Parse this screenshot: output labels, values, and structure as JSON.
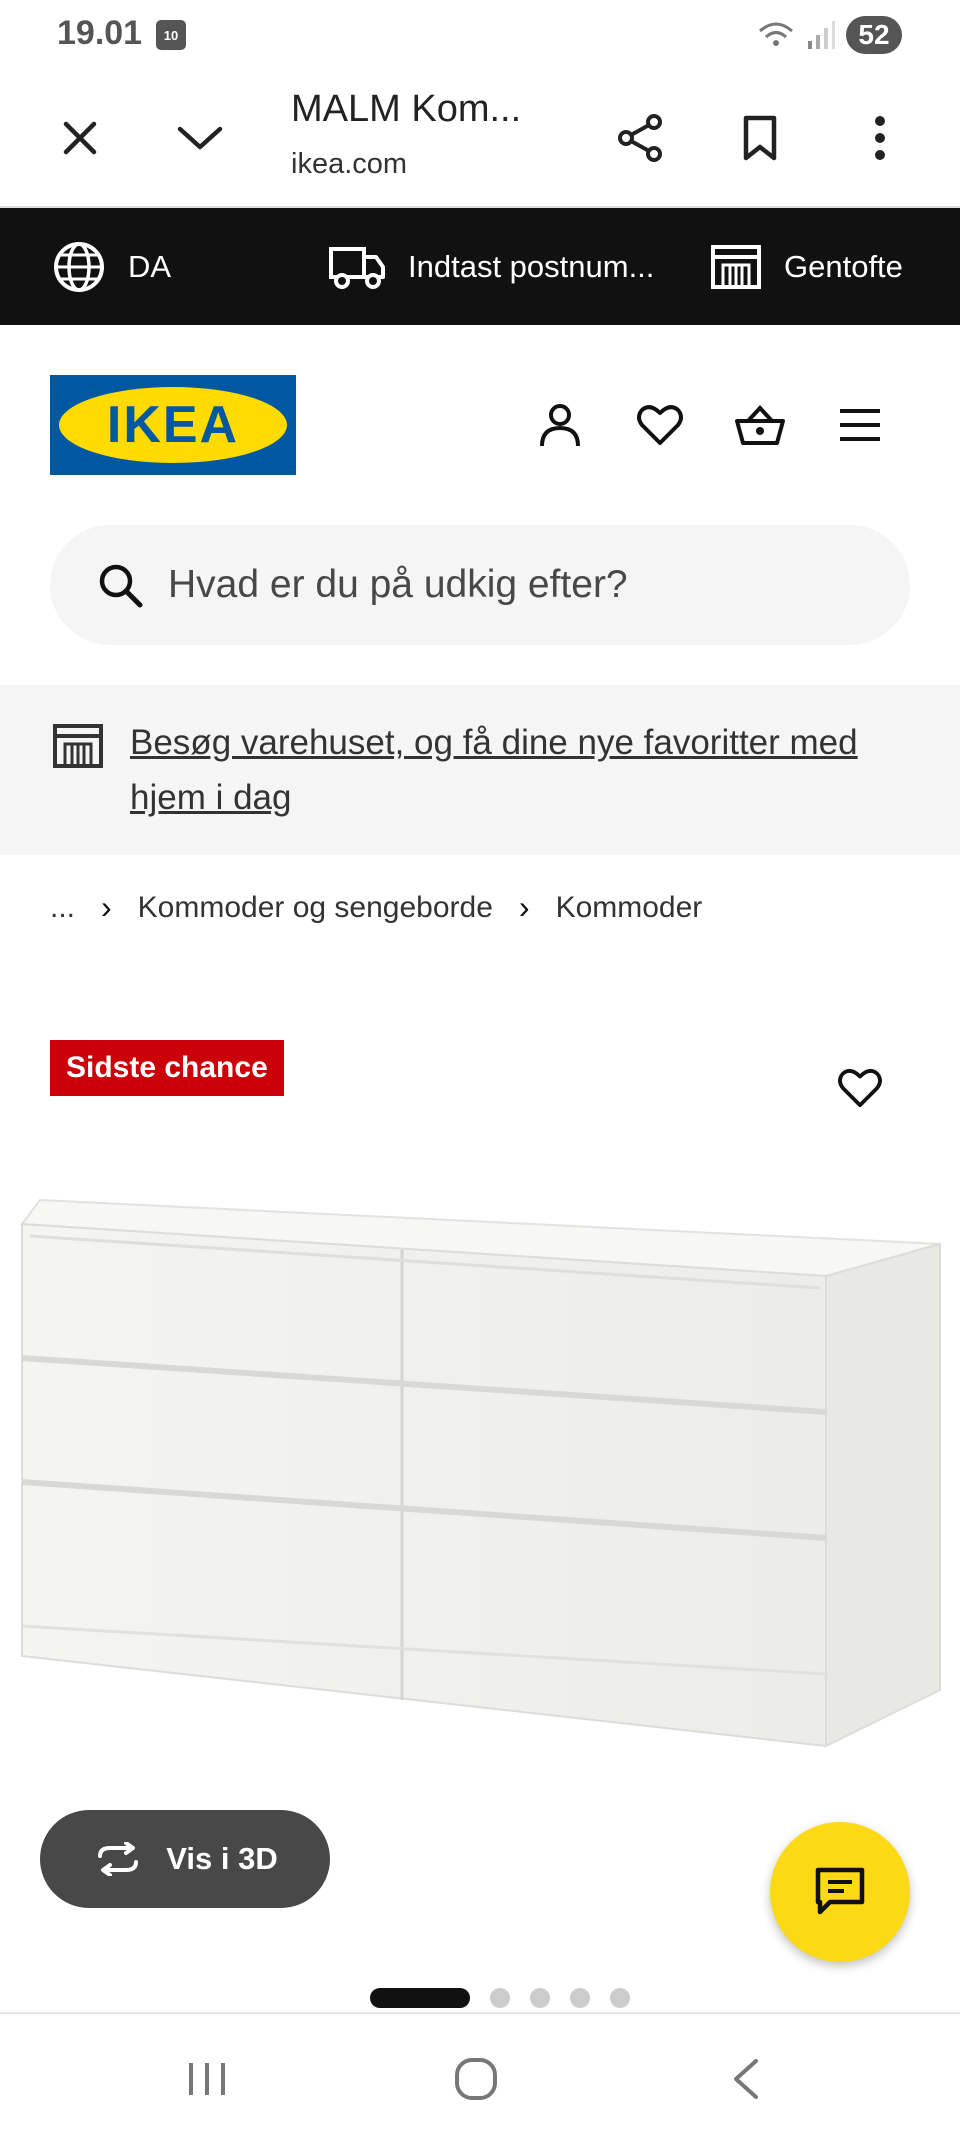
{
  "status_bar": {
    "time": "19.01",
    "calendar_day": "10",
    "battery": "52"
  },
  "browser": {
    "title": "MALM Kom...",
    "url": "ikea.com"
  },
  "info_strip": {
    "language": "DA",
    "delivery": "Indtast postnum...",
    "store": "Gentofte"
  },
  "brand": {
    "logo_text": "IKEA",
    "blue": "#0058a3",
    "yellow": "#ffdb00"
  },
  "search": {
    "placeholder": "Hvad er du på udkig efter?"
  },
  "banner": {
    "link": "Besøg varehuset, og få dine nye favoritter med hjem i dag"
  },
  "breadcrumb": {
    "ellipsis": "...",
    "items": [
      "Kommoder og sengeborde",
      "Kommoder"
    ]
  },
  "product": {
    "badge": "Sidste chance",
    "badge_color": "#cc0008",
    "view_3d": "Vis i 3D"
  },
  "carousel": {
    "total": 5,
    "active": 1
  },
  "icons": [
    "close-icon",
    "chevron-down-icon",
    "share-icon",
    "bookmark-icon",
    "more-icon",
    "globe-icon",
    "truck-icon",
    "store-icon",
    "user-icon",
    "heart-icon",
    "basket-icon",
    "menu-icon",
    "search-icon",
    "rotate-icon",
    "chat-icon"
  ]
}
